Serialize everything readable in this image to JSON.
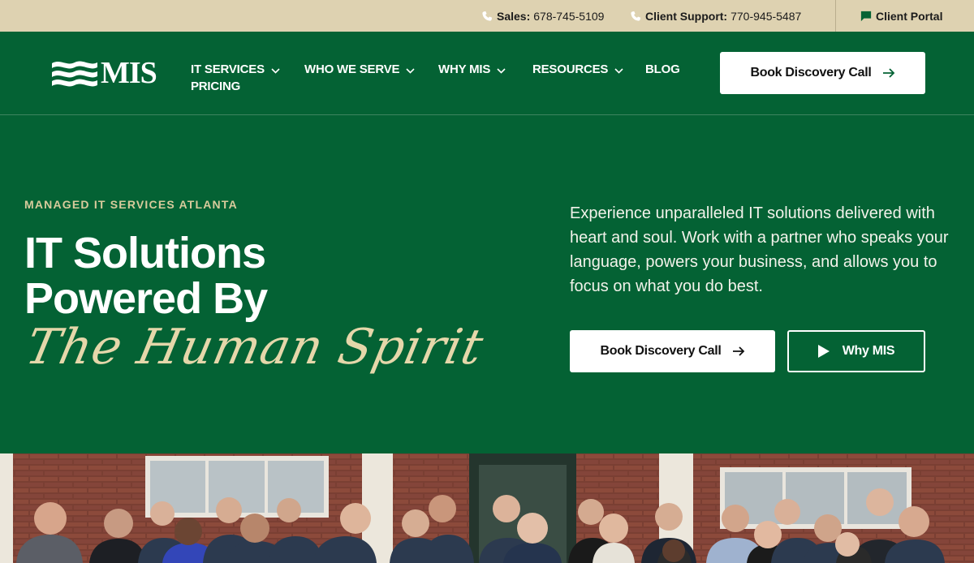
{
  "topbar": {
    "sales_label": "Sales:",
    "sales_phone": "678-745-5109",
    "support_label": "Client Support:",
    "support_phone": "770-945-5487",
    "portal_label": "Client Portal"
  },
  "header": {
    "logo_text": "MIS",
    "nav": [
      {
        "label": "IT SERVICES",
        "has_dropdown": true
      },
      {
        "label": "WHO WE SERVE",
        "has_dropdown": true
      },
      {
        "label": "WHY MIS",
        "has_dropdown": true
      },
      {
        "label": "RESOURCES",
        "has_dropdown": true
      },
      {
        "label": "BLOG",
        "has_dropdown": false
      },
      {
        "label": "PRICING",
        "has_dropdown": false
      }
    ],
    "cta_label": "Book Discovery Call"
  },
  "hero": {
    "eyebrow": "MANAGED IT SERVICES ATLANTA",
    "headline_line1": "IT Solutions",
    "headline_line2": "Powered By",
    "script_line": "The Human Spirit",
    "intro": "Experience unparalleled IT solutions delivered with heart and soul. Work with a partner who speaks your language, powers your business, and allows you to focus on what you do best.",
    "primary_cta": "Book Discovery Call",
    "secondary_cta": "Why MIS"
  },
  "colors": {
    "brand_green": "#046234",
    "topbar_tan": "#ded2b1",
    "accent_gold": "#d8cb9c",
    "white": "#ffffff"
  },
  "icons": [
    "phone-icon",
    "chat-icon",
    "chevron-down-icon",
    "arrow-right-icon",
    "play-icon",
    "wave-logo-icon"
  ]
}
